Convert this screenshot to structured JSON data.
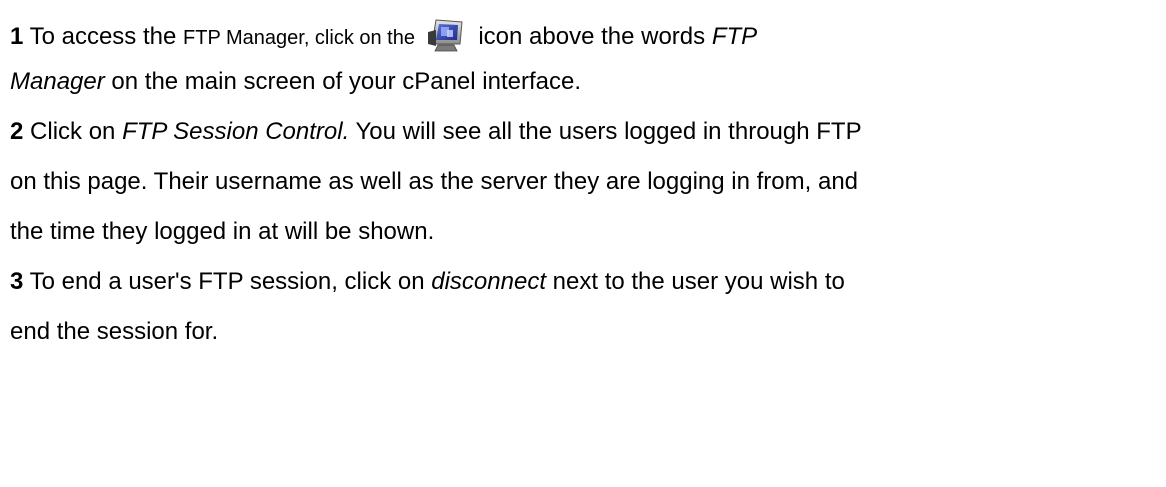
{
  "steps": [
    {
      "number": "1",
      "text_a": "To access the",
      "text_b": "FTP Manager, click on the",
      "text_c": "icon above the words",
      "text_d": "FTP",
      "text_e": "Manager",
      "text_f": "on the main screen of your cPanel interface."
    },
    {
      "number": "2",
      "text_a": "Click on",
      "text_b": "FTP Session Control.",
      "text_c": "You will see all the users logged in through FTP",
      "text_d": "on this page. Their username as well as the server they are logging in from, and",
      "text_e": "the time they logged in at will be shown."
    },
    {
      "number": "3",
      "text_a": "To end a user's FTP session, click on",
      "text_b": "disconnect",
      "text_c": "next to the user you wish to",
      "text_d": "end the session for."
    }
  ],
  "icons": {
    "ftp_manager_icon": "monitor-icon"
  }
}
